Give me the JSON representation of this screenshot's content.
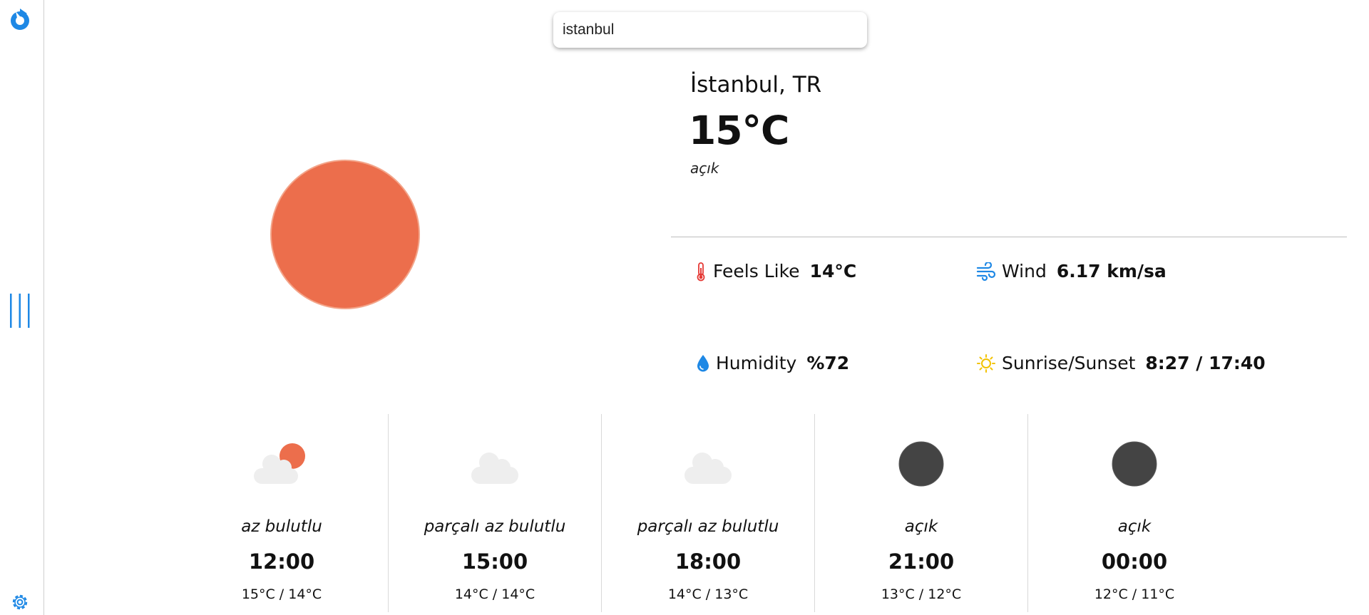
{
  "search": {
    "value": "istanbul"
  },
  "current": {
    "location": "İstanbul, TR",
    "temperature": "15°C",
    "description": "açık",
    "icon": "sun-icon"
  },
  "stats": {
    "feels_like": {
      "label": "Feels Like",
      "value": "14°C",
      "icon": "thermometer-icon"
    },
    "wind": {
      "label": "Wind",
      "value": "6.17 km/sa",
      "icon": "wind-icon"
    },
    "humidity": {
      "label": "Humidity",
      "value": "%72",
      "icon": "droplet-icon"
    },
    "sunrise_sunset": {
      "label": "Sunrise/Sunset",
      "value": "8:27 / 17:40",
      "icon": "sun-outline-icon"
    }
  },
  "forecast": [
    {
      "description": "az bulutlu",
      "time": "12:00",
      "range": "15°C / 14°C",
      "icon": "partly-cloudy-icon"
    },
    {
      "description": "parçalı az bulutlu",
      "time": "15:00",
      "range": "14°C / 14°C",
      "icon": "cloud-icon"
    },
    {
      "description": "parçalı az bulutlu",
      "time": "18:00",
      "range": "14°C / 13°C",
      "icon": "cloud-icon"
    },
    {
      "description": "açık",
      "time": "21:00",
      "range": "13°C / 12°C",
      "icon": "moon-icon"
    },
    {
      "description": "açık",
      "time": "00:00",
      "range": "12°C / 11°C",
      "icon": "moon-icon"
    }
  ],
  "colors": {
    "accent": "#1e88e5",
    "sun": "#ec6e4c",
    "cloud": "#eeeeee",
    "night": "#444444",
    "thermometer": "#e53935",
    "sunrise": "#f2c200"
  }
}
